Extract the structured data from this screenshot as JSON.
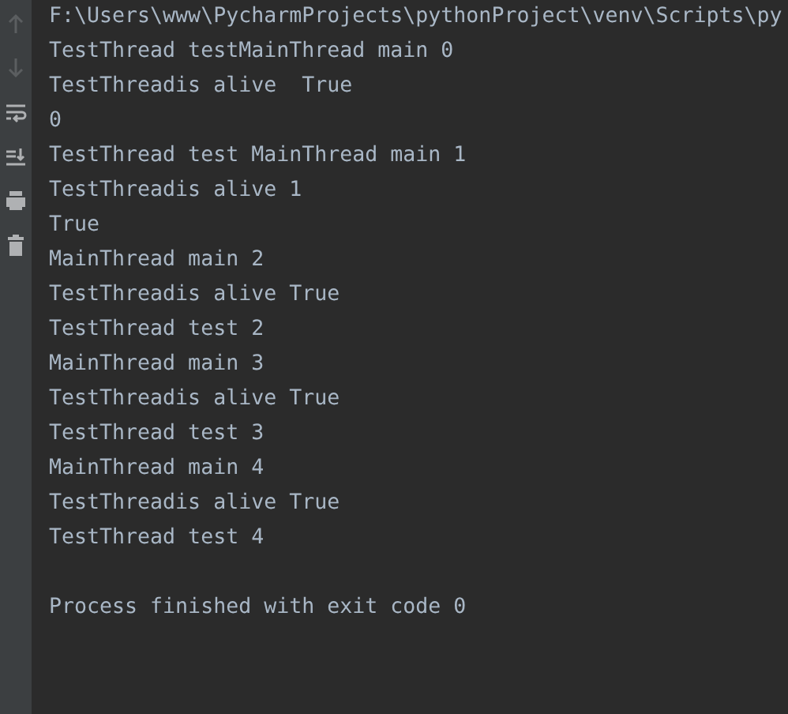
{
  "toolbar": [
    {
      "kind": "up",
      "disabled": true
    },
    {
      "kind": "down",
      "disabled": true
    },
    {
      "kind": "wrap",
      "disabled": false
    },
    {
      "kind": "scroll-end",
      "disabled": false
    },
    {
      "kind": "print",
      "disabled": false
    },
    {
      "kind": "trash",
      "disabled": false
    }
  ],
  "console": {
    "lines": [
      "F:\\Users\\www\\PycharmProjects\\pythonProject\\venv\\Scripts\\py",
      "TestThread testMainThread main 0",
      "TestThreadis alive  True",
      "0",
      "TestThread test MainThread main 1",
      "TestThreadis alive 1",
      "True",
      "MainThread main 2",
      "TestThreadis alive True",
      "TestThread test 2",
      "MainThread main 3",
      "TestThreadis alive True",
      "TestThread test 3",
      "MainThread main 4",
      "TestThreadis alive True",
      "TestThread test 4"
    ],
    "exit_message": "Process finished with exit code 0"
  }
}
